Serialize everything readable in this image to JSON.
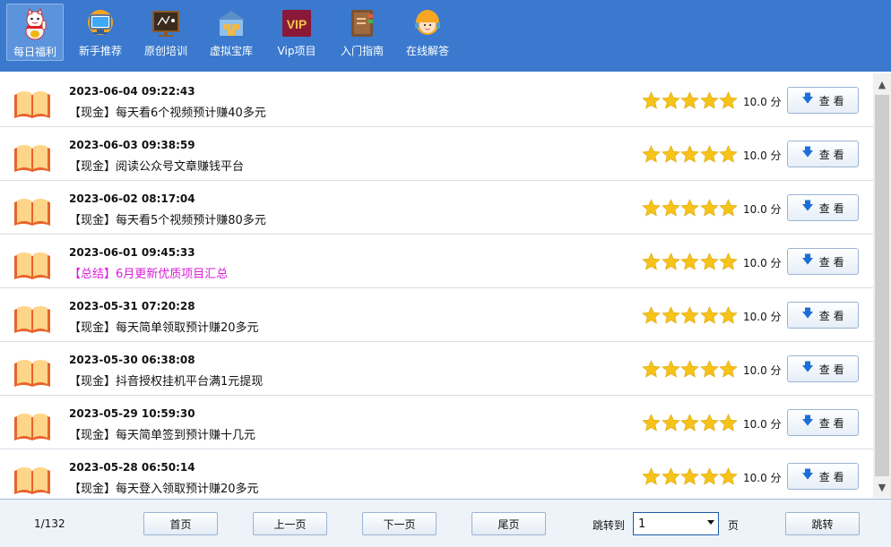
{
  "toolbar": {
    "items": [
      {
        "label": "每日福利",
        "icon": "lucky-cat-icon",
        "active": true
      },
      {
        "label": "新手推荐",
        "icon": "monitor-icon",
        "active": false
      },
      {
        "label": "原创培训",
        "icon": "blackboard-icon",
        "active": false
      },
      {
        "label": "虚拟宝库",
        "icon": "warehouse-icon",
        "active": false
      },
      {
        "label": "Vip项目",
        "icon": "vip-icon",
        "active": false
      },
      {
        "label": "入门指南",
        "icon": "book-icon",
        "active": false
      },
      {
        "label": "在线解答",
        "icon": "support-agent-icon",
        "active": false
      }
    ],
    "vip_text": "VIP"
  },
  "list": {
    "rows": [
      {
        "date": "2023-06-04 09:22:43",
        "title": "【现金】每天看6个视频预计赚40多元",
        "score": "10.0 分",
        "stars": 5,
        "button": "查 看"
      },
      {
        "date": "2023-06-03 09:38:59",
        "title": "【现金】阅读公众号文章赚钱平台",
        "score": "10.0 分",
        "stars": 5,
        "button": "查 看"
      },
      {
        "date": "2023-06-02 08:17:04",
        "title": "【现金】每天看5个视频预计赚80多元",
        "score": "10.0 分",
        "stars": 5,
        "button": "查 看"
      },
      {
        "date": "2023-06-01 09:45:33",
        "title": "【总结】6月更新优质项目汇总",
        "score": "10.0 分",
        "stars": 5,
        "button": "查 看",
        "highlight": true
      },
      {
        "date": "2023-05-31 07:20:28",
        "title": "【现金】每天简单领取预计赚20多元",
        "score": "10.0 分",
        "stars": 5,
        "button": "查 看"
      },
      {
        "date": "2023-05-30 06:38:08",
        "title": "【现金】抖音授权挂机平台满1元提现",
        "score": "10.0 分",
        "stars": 5,
        "button": "查 看"
      },
      {
        "date": "2023-05-29 10:59:30",
        "title": "【现金】每天简单签到预计赚十几元",
        "score": "10.0 分",
        "stars": 5,
        "button": "查 看"
      },
      {
        "date": "2023-05-28 06:50:14",
        "title": "【现金】每天登入领取预计赚20多元",
        "score": "10.0 分",
        "stars": 5,
        "button": "查 看"
      }
    ]
  },
  "footer": {
    "page_info": "1/132",
    "first": "首页",
    "prev": "上一页",
    "next": "下一页",
    "last": "尾页",
    "jump_label": "跳转到",
    "jump_value": "1",
    "page_suffix": "页",
    "jump_button": "跳转"
  },
  "colors": {
    "toolbar_bg": "#3a79cd",
    "star": "#f7c31a",
    "highlight_title": "#d81cd6",
    "book_cover": "#e8642a",
    "book_pages": "#ffd58a"
  }
}
